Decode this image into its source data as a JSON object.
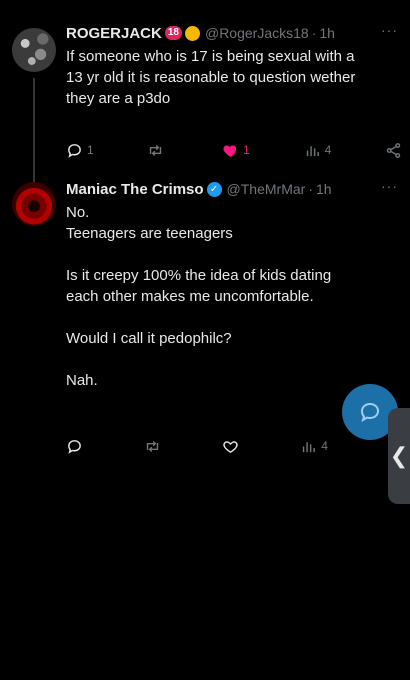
{
  "tweets": [
    {
      "name": "ROGERJACK",
      "badge": "18",
      "handle": "@RogerJacks18",
      "separator": "·",
      "time": "1h",
      "more": "···",
      "text": [
        "If someone who is 17 is being sexual with a",
        "13 yr old it is reasonable to question wether",
        "they are a p3do"
      ],
      "actions": {
        "replies": "1",
        "retweets": "",
        "likes": "1",
        "views": "4"
      },
      "liked": true
    },
    {
      "name": "Maniac The Crimso",
      "verified_mark": "✓",
      "handle": "@TheMrMar",
      "separator": "·",
      "time": "1h",
      "more": "···",
      "paragraphs": [
        "No.",
        "Teenagers are teenagers",
        "",
        "Is it creepy 100% the idea of kids dating",
        "each other makes me uncomfortable.",
        "",
        "Would I call it pedophilc?",
        "",
        "Nah."
      ],
      "actions": {
        "replies": "",
        "retweets": "",
        "likes": "",
        "views": "4"
      },
      "liked": false
    }
  ],
  "side_handle": {
    "glyph": "❮"
  },
  "colors": {
    "background": "#000000",
    "text": "#e7e9ea",
    "muted": "#71767b",
    "like_active": "#f91880",
    "verified": "#1d9bf0",
    "fab": "#1d6fa8"
  },
  "icons": [
    "reply-icon",
    "retweet-icon",
    "like-icon",
    "views-icon",
    "share-icon",
    "compose-icon",
    "chevron-left-icon",
    "verified-icon",
    "more-icon"
  ]
}
